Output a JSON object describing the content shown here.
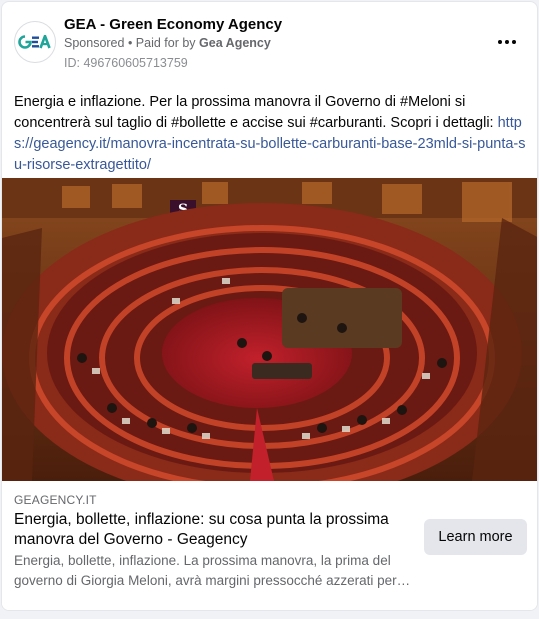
{
  "post": {
    "page_name": "GEA - Green Economy Agency",
    "sponsored_label": "Sponsored",
    "separator": " • ",
    "paid_for_prefix": "Paid for by ",
    "paid_for_name": "Gea Agency",
    "ad_id": "ID: 496760605713759",
    "more_icon": "more-horizontal-icon",
    "avatar_text": "GEA",
    "body_text": "Energia e inflazione. Per la prossima manovra il Governo di #Meloni si concentrerà sul taglio di #bollette e accise sui #carburanti. Scopri i dettagli:",
    "body_link": "https://geagency.it/manovra-incentrata-su-bollette-carburanti-base-23mld-si-punta-su-risorse-extragettito/"
  },
  "link_preview": {
    "domain": "GEAGENCY.IT",
    "headline": "Energia, bollette, inflazione: su cosa punta la prossima manovra del Governo - Geagency",
    "description": "Energia, bollette, inflazione. La prossima manovra, la prima del governo di Giorgia Meloni, avrà margini pressocché azzerati per…",
    "cta_label": "Learn more"
  },
  "colors": {
    "brand_teal": "#1fa59a",
    "brand_blue": "#1f4e9c",
    "link": "#385898",
    "cta_bg": "#e4e6eb"
  }
}
